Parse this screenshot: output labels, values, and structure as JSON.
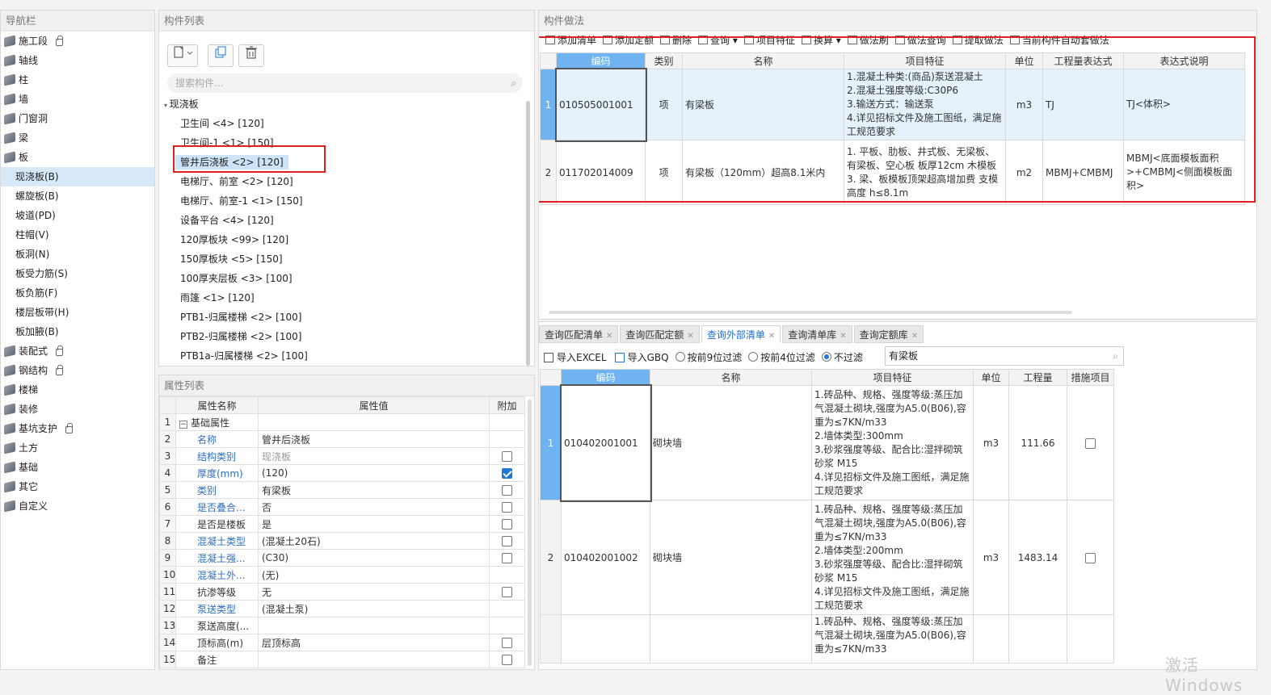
{
  "nav": {
    "title": "导航栏",
    "items": [
      {
        "label": "施工段",
        "lock": true,
        "sub": false,
        "sel": false
      },
      {
        "label": "轴线",
        "lock": false,
        "sub": false,
        "sel": false
      },
      {
        "label": "柱",
        "lock": false,
        "sub": false,
        "sel": false
      },
      {
        "label": "墙",
        "lock": false,
        "sub": false,
        "sel": false
      },
      {
        "label": "门窗洞",
        "lock": false,
        "sub": false,
        "sel": false
      },
      {
        "label": "梁",
        "lock": false,
        "sub": false,
        "sel": false
      },
      {
        "label": "板",
        "lock": false,
        "sub": false,
        "sel": false
      },
      {
        "label": "现浇板(B)",
        "lock": false,
        "sub": true,
        "sel": true
      },
      {
        "label": "螺旋板(B)",
        "lock": false,
        "sub": true,
        "sel": false
      },
      {
        "label": "坡道(PD)",
        "lock": false,
        "sub": true,
        "sel": false
      },
      {
        "label": "柱帽(V)",
        "lock": false,
        "sub": true,
        "sel": false
      },
      {
        "label": "板洞(N)",
        "lock": false,
        "sub": true,
        "sel": false
      },
      {
        "label": "板受力筋(S)",
        "lock": false,
        "sub": true,
        "sel": false
      },
      {
        "label": "板负筋(F)",
        "lock": false,
        "sub": true,
        "sel": false
      },
      {
        "label": "楼层板带(H)",
        "lock": false,
        "sub": true,
        "sel": false
      },
      {
        "label": "板加腋(B)",
        "lock": false,
        "sub": true,
        "sel": false
      },
      {
        "label": "装配式",
        "lock": true,
        "sub": false,
        "sel": false
      },
      {
        "label": "钢结构",
        "lock": true,
        "sub": false,
        "sel": false
      },
      {
        "label": "楼梯",
        "lock": false,
        "sub": false,
        "sel": false
      },
      {
        "label": "装修",
        "lock": false,
        "sub": false,
        "sel": false
      },
      {
        "label": "基坑支护",
        "lock": true,
        "sub": false,
        "sel": false
      },
      {
        "label": "土方",
        "lock": false,
        "sub": false,
        "sel": false
      },
      {
        "label": "基础",
        "lock": false,
        "sub": false,
        "sel": false
      },
      {
        "label": "其它",
        "lock": false,
        "sub": false,
        "sel": false
      },
      {
        "label": "自定义",
        "lock": false,
        "sub": false,
        "sel": false
      }
    ]
  },
  "comp": {
    "title": "构件列表",
    "search_placeholder": "搜索构件...",
    "group": "现浇板",
    "items": [
      "卫生间 <4> [120]",
      "卫生间-1 <1> [150]",
      "管井后浇板 <2> [120]",
      "电梯厅、前室 <2> [120]",
      "电梯厅、前室-1 <1> [150]",
      "设备平台 <4> [120]",
      "120厚板块 <99> [120]",
      "150厚板块 <5> [150]",
      "100厚夹层板 <3> [100]",
      "雨篷 <1> [120]",
      "PTB1-归属楼梯 <2> [100]",
      "PTB2-归属楼梯 <2> [100]",
      "PTB1a-归属楼梯 <2> [100]"
    ]
  },
  "prop": {
    "title": "属性列表",
    "headers": [
      "属性名称",
      "属性值",
      "附加"
    ],
    "rows": [
      {
        "n": "1",
        "name": "基础属性",
        "value": "",
        "check": "none",
        "nameStyle": "group",
        "valStyle": ""
      },
      {
        "n": "2",
        "name": "名称",
        "value": "管井后浇板",
        "check": "none",
        "nameStyle": "blue",
        "valStyle": ""
      },
      {
        "n": "3",
        "name": "结构类别",
        "value": "现浇板",
        "check": "off",
        "nameStyle": "blue",
        "valStyle": "gray"
      },
      {
        "n": "4",
        "name": "厚度(mm)",
        "value": "(120)",
        "check": "on",
        "nameStyle": "blue",
        "valStyle": ""
      },
      {
        "n": "5",
        "name": "类别",
        "value": "有梁板",
        "check": "off",
        "nameStyle": "blue",
        "valStyle": ""
      },
      {
        "n": "6",
        "name": "是否叠合...",
        "value": "否",
        "check": "off",
        "nameStyle": "blue",
        "valStyle": ""
      },
      {
        "n": "7",
        "name": "是否是楼板",
        "value": "是",
        "check": "off",
        "nameStyle": "",
        "valStyle": ""
      },
      {
        "n": "8",
        "name": "混凝土类型",
        "value": "(混凝土20石)",
        "check": "off",
        "nameStyle": "blue",
        "valStyle": ""
      },
      {
        "n": "9",
        "name": "混凝土强...",
        "value": "(C30)",
        "check": "off",
        "nameStyle": "blue",
        "valStyle": ""
      },
      {
        "n": "10",
        "name": "混凝土外...",
        "value": "(无)",
        "check": "none",
        "nameStyle": "blue",
        "valStyle": ""
      },
      {
        "n": "11",
        "name": "抗渗等级",
        "value": "无",
        "check": "off",
        "nameStyle": "",
        "valStyle": ""
      },
      {
        "n": "12",
        "name": "泵送类型",
        "value": "(混凝土泵)",
        "check": "none",
        "nameStyle": "blue",
        "valStyle": ""
      },
      {
        "n": "13",
        "name": "泵送高度(...",
        "value": "",
        "check": "none",
        "nameStyle": "",
        "valStyle": ""
      },
      {
        "n": "14",
        "name": "顶标高(m)",
        "value": "层顶标高",
        "check": "off",
        "nameStyle": "",
        "valStyle": ""
      },
      {
        "n": "15",
        "name": "备注",
        "value": "",
        "check": "off",
        "nameStyle": "",
        "valStyle": ""
      }
    ]
  },
  "method": {
    "title": "构件做法",
    "toolbar": [
      "添加清单",
      "添加定额",
      "删除",
      "查询 ▾",
      "项目特征",
      "换算 ▾",
      "做法刷",
      "做法查询",
      "提取做法",
      "当前构件自动套做法"
    ],
    "headers": [
      "编码",
      "类别",
      "名称",
      "项目特征",
      "单位",
      "工程量表达式",
      "表达式说明"
    ],
    "rows": [
      {
        "n": "1",
        "code": "010505001001",
        "type": "项",
        "name": "有梁板",
        "feature": "1.混凝土种类:(商品)泵送混凝土\n2.混凝土强度等级:C30P6\n3.输送方式：输送泵\n4.详见招标文件及施工图纸，满足施工规范要求",
        "unit": "m3",
        "expr": "TJ",
        "desc": "TJ<体积>"
      },
      {
        "n": "2",
        "code": "011702014009",
        "type": "项",
        "name": "有梁板（120mm）超高8.1米内",
        "feature": "1. 平板、肋板、井式板、无梁板、有梁板、空心板 板厚12cm 木模板\n3. 梁、板模板顶架超高增加费 支模高度 h≤8.1m",
        "unit": "m2",
        "expr": "MBMJ+CMBMJ",
        "desc": "MBMJ<底面模板面积>+CMBMJ<侧面模板面积>"
      }
    ]
  },
  "query": {
    "tabs": [
      "查询匹配清单",
      "查询匹配定额",
      "查询外部清单",
      "查询清单库",
      "查询定额库"
    ],
    "active_tab": "查询外部清单",
    "import_excel": "导入EXCEL",
    "import_gbq": "导入GBQ",
    "radio1": "按前9位过滤",
    "radio2": "按前4位过滤",
    "radio3": "不过滤",
    "search_value": "有梁板",
    "headers": [
      "编码",
      "名称",
      "项目特征",
      "单位",
      "工程量",
      "措施项目"
    ],
    "rows": [
      {
        "n": "1",
        "code": "010402001001",
        "name": "砌块墙",
        "feature": "1.砖品种、规格、强度等级:蒸压加气混凝土砌块,强度为A5.0(B06),容重为≤7KN/m33\n2.墙体类型:300mm\n3.砂浆强度等级、配合比:湿拌砌筑砂浆 M15\n4.详见招标文件及施工图纸，满足施工规范要求",
        "unit": "m3",
        "qty": "111.66"
      },
      {
        "n": "2",
        "code": "010402001002",
        "name": "砌块墙",
        "feature": "1.砖品种、规格、强度等级:蒸压加气混凝土砌块,强度为A5.0(B06),容重为≤7KN/m33\n2.墙体类型:200mm\n3.砂浆强度等级、配合比:湿拌砌筑砂浆 M15\n4.详见招标文件及施工图纸，满足施工规范要求",
        "unit": "m3",
        "qty": "1483.14"
      },
      {
        "n": "",
        "code": "",
        "name": "",
        "feature": "1.砖品种、规格、强度等级:蒸压加气混凝土砌块,强度为A5.0(B06),容重为≤7KN/m33",
        "unit": "",
        "qty": ""
      }
    ]
  },
  "watermark": "激活 Windows",
  "colors": {
    "accent": "#1e6fd0",
    "selected": "#6fb3f1",
    "highlight_box": "#e02020"
  }
}
